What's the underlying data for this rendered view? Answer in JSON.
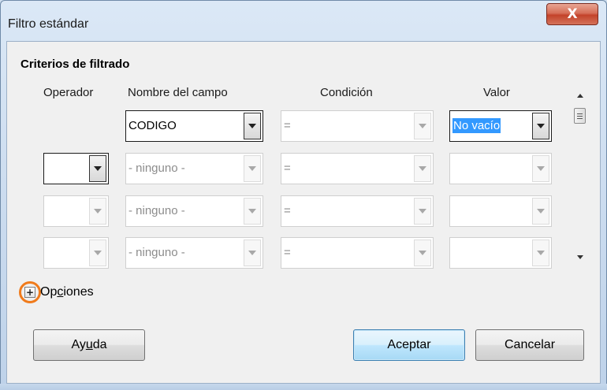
{
  "window": {
    "title": "Filtro estándar",
    "close_label": "X"
  },
  "group": {
    "title": "Criterios de filtrado"
  },
  "columns": {
    "operator": "Operador",
    "field": "Nombre del campo",
    "condition": "Condición",
    "value": "Valor"
  },
  "rows": [
    {
      "operator": "",
      "field": "CODIGO",
      "condition": "=",
      "value": "No vacío"
    },
    {
      "operator": "",
      "field": "- ninguno -",
      "condition": "=",
      "value": ""
    },
    {
      "operator": "",
      "field": "- ninguno -",
      "condition": "=",
      "value": ""
    },
    {
      "operator": "",
      "field": "- ninguno -",
      "condition": "=",
      "value": ""
    }
  ],
  "options": {
    "label_pre": "Op",
    "label_accel": "c",
    "label_post": "iones"
  },
  "buttons": {
    "help_pre": "Ay",
    "help_accel": "u",
    "help_post": "da",
    "ok": "Aceptar",
    "cancel": "Cancelar"
  },
  "colors": {
    "selection": "#3399ff",
    "highlight_ring": "#f07b1c",
    "close_button": "#c3432a"
  }
}
